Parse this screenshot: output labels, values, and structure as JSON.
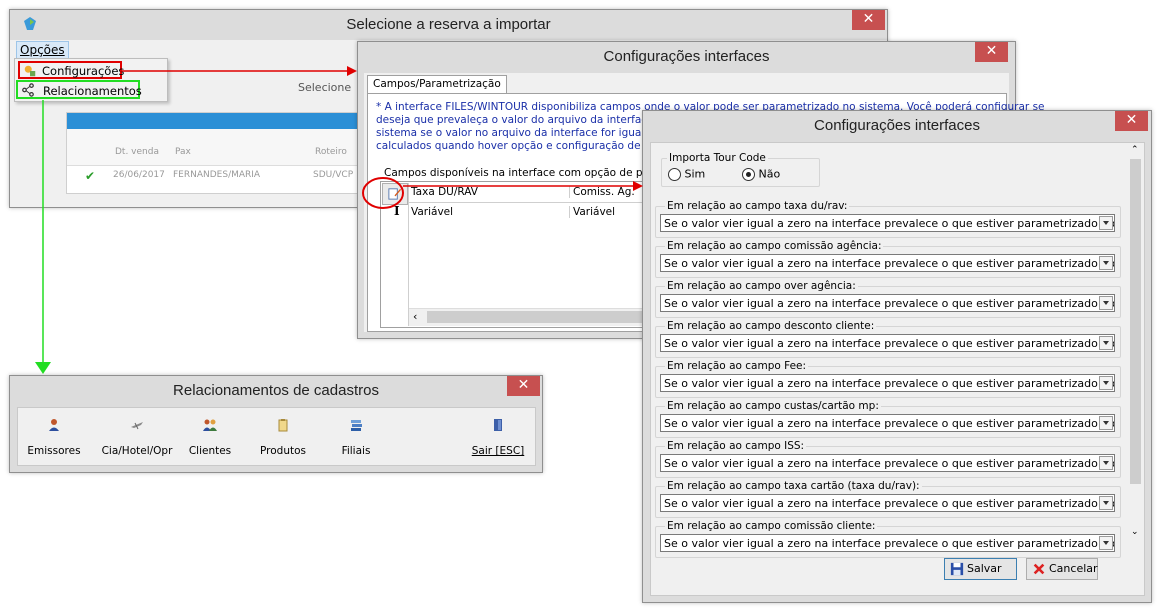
{
  "win_reserva": {
    "title": "Selecione a reserva a importar",
    "menu": {
      "opcoes": "Opções"
    },
    "dropdown": [
      "Configurações",
      "Relacionamentos"
    ],
    "hint_label": "Selecione",
    "grid": {
      "headers": [
        "Dt. venda",
        "Pax",
        "Roteiro"
      ],
      "row": {
        "date": "26/06/2017",
        "pax": "FERNANDES/MARIA",
        "roteiro": "SDU/VCP"
      }
    }
  },
  "win_config1": {
    "title": "Configurações interfaces",
    "tab": "Campos/Parametrização",
    "info_lines": [
      "* A interface FILES/WINTOUR disponibiliza campos onde o valor pode ser parametrizado no sistema. Você poderá configurar se",
      "deseja que prevaleça o valor do arquivo da interface, se",
      "sistema se o valor no arquivo da interface for igual a zero",
      "calculados quando hover opção e configuração de parame"
    ],
    "campos_label": "Campos disponíveis na interface com opção de parame",
    "grid": {
      "headers": [
        "Taxa DU/RAV",
        "Comiss. Ag."
      ],
      "row": [
        "Variável",
        "Variável"
      ]
    }
  },
  "win_config2": {
    "title": "Configurações interfaces",
    "importa_label": "Importa Tour Code",
    "radio_sim": "Sim",
    "radio_nao": "Não",
    "radio_selected": "Não",
    "option_text": "Se o valor vier igual a zero na interface prevalece o que estiver parametrizado no Wintour.",
    "groups": [
      "Em relação ao campo taxa du/rav:",
      "Em relação ao campo comissão agência:",
      "Em relação ao campo over agência:",
      "Em relação ao campo desconto cliente:",
      "Em relação ao campo Fee:",
      "Em relação ao campo custas/cartão mp:",
      "Em relação ao campo ISS:",
      "Em relação ao campo taxa cartão (taxa du/rav):",
      "Em relação ao campo comissão cliente:"
    ],
    "btn_salvar": "Salvar",
    "btn_cancelar": "Cancelar"
  },
  "win_rel": {
    "title": "Relacionamentos de cadastros",
    "items": [
      "Emissores",
      "Cia/Hotel/Opr",
      "Clientes",
      "Produtos",
      "Filiais",
      "Sair [ESC]"
    ]
  },
  "colors": {
    "highlight_red": "#e00000",
    "highlight_green": "#22dd22",
    "close_red": "#c75050",
    "grid_blue": "#2b8fd6"
  }
}
